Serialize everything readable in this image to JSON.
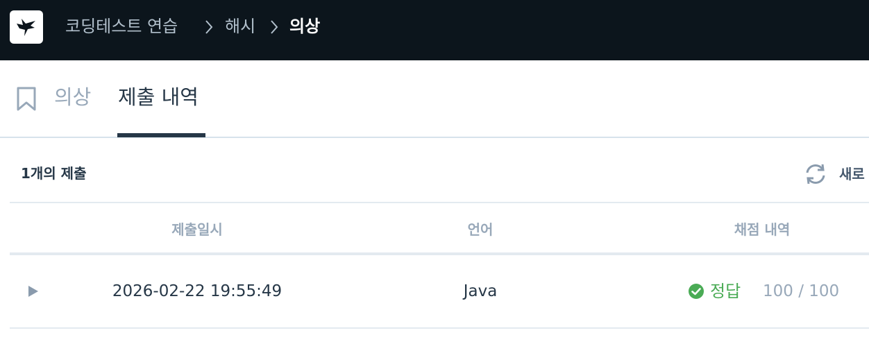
{
  "header": {
    "breadcrumb": [
      "코딩테스트 연습",
      "해시",
      "의상"
    ]
  },
  "tabs": [
    {
      "label": "의상",
      "active": false
    },
    {
      "label": "제출 내역",
      "active": true
    }
  ],
  "submissions": {
    "count_label": "1개의 제출",
    "refresh_label": "새로",
    "columns": [
      "제출일시",
      "언어",
      "채점 내역"
    ],
    "rows": [
      {
        "datetime": "2026-02-22 19:55:49",
        "language": "Java",
        "result": "정답",
        "score": "100 / 100"
      }
    ]
  },
  "colors": {
    "topbar": "#0c151c",
    "text_primary": "#263747",
    "text_muted": "#98a8b9",
    "success": "#4aab55"
  }
}
